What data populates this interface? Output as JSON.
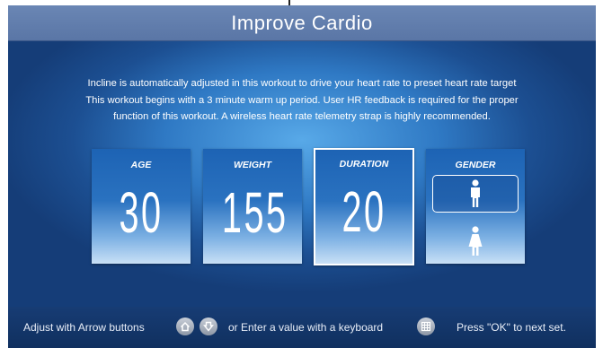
{
  "title": "Improve Cardio",
  "description": [
    "Incline is automatically adjusted in this workout to drive your heart rate to preset heart rate target",
    "This workout begins with a 3 minute warm up period. User HR feedback is required for the proper",
    "function of this workout. A wireless heart rate  telemetry strap is highly recommended."
  ],
  "fields": {
    "age": {
      "label": "AGE",
      "value": "30"
    },
    "weight": {
      "label": "WEIGHT",
      "value": "155"
    },
    "duration": {
      "label": "DURATION",
      "value": "20",
      "selected": true
    },
    "gender": {
      "label": "GENDER",
      "options": [
        "male",
        "female"
      ],
      "selected": "male"
    }
  },
  "footer": {
    "adjust_text": "Adjust with Arrow buttons",
    "or_text": "or  Enter a value with a keyboard",
    "next_text": "Press \"OK\" to next set."
  },
  "icons": {
    "up": "home-arrow-up-icon",
    "down": "arrow-down-icon",
    "keyboard": "keyboard-icon",
    "male": "male-icon",
    "female": "female-icon"
  },
  "colors": {
    "title_bar": "#6a86b4",
    "card_top": "#1d63b4",
    "footer_bar": "#173c74"
  }
}
